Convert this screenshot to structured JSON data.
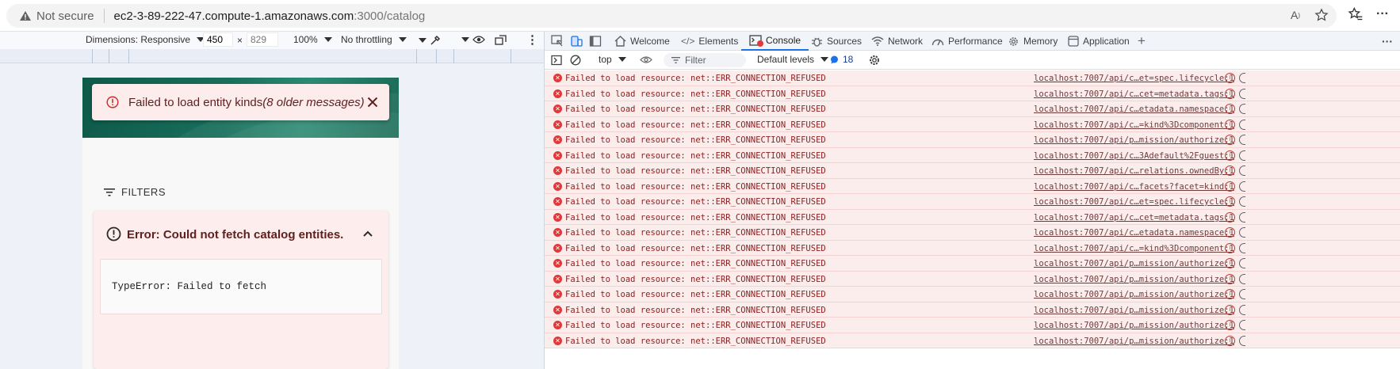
{
  "browser": {
    "security_label": "Not secure",
    "url_host": "ec2-3-89-222-47.compute-1.amazonaws.com",
    "url_path": ":3000/catalog",
    "more_label": "···"
  },
  "device_toolbar": {
    "dimensions_label": "Dimensions: Responsive",
    "width": "450",
    "times": "×",
    "height": "829",
    "zoom": "100%",
    "throttling": "No throttling"
  },
  "app": {
    "toast_message": "Failed to load entity kinds",
    "toast_older": "(8 older messages)",
    "filters_label": "FILTERS",
    "error_title": "Error: Could not fetch catalog entities.",
    "error_message": "TypeError: Failed to fetch"
  },
  "devtools": {
    "tabs": [
      {
        "label": "Welcome",
        "icon": "home-icon"
      },
      {
        "label": "Elements",
        "icon": "code-icon"
      },
      {
        "label": "Console",
        "icon": "console-icon"
      },
      {
        "label": "Sources",
        "icon": "bug-icon"
      },
      {
        "label": "Network",
        "icon": "wifi-icon"
      },
      {
        "label": "Performance",
        "icon": "gauge-icon"
      },
      {
        "label": "Memory",
        "icon": "gear-icon"
      },
      {
        "label": "Application",
        "icon": "window-icon"
      }
    ],
    "add_tab": "+",
    "more": "···",
    "console_bar": {
      "context": "top",
      "filter_placeholder": "Filter",
      "levels": "Default levels",
      "message_count": "18"
    },
    "log": [
      {
        "message": "Failed to load resource: net::ERR_CONNECTION_REFUSED",
        "source": "localhost:7007/api/c…et=spec.lifecycle:1"
      },
      {
        "message": "Failed to load resource: net::ERR_CONNECTION_REFUSED",
        "source": "localhost:7007/api/c…cet=metadata.tags:1"
      },
      {
        "message": "Failed to load resource: net::ERR_CONNECTION_REFUSED",
        "source": "localhost:7007/api/c…etadata.namespace:1"
      },
      {
        "message": "Failed to load resource: net::ERR_CONNECTION_REFUSED",
        "source": "localhost:7007/api/c…=kind%3Dcomponent:1"
      },
      {
        "message": "Failed to load resource: net::ERR_CONNECTION_REFUSED",
        "source": "localhost:7007/api/p…mission/authorize:1"
      },
      {
        "message": "Failed to load resource: net::ERR_CONNECTION_REFUSED",
        "source": "localhost:7007/api/c…3Adefault%2Fguest:1"
      },
      {
        "message": "Failed to load resource: net::ERR_CONNECTION_REFUSED",
        "source": "localhost:7007/api/c…relations.ownedBy:1"
      },
      {
        "message": "Failed to load resource: net::ERR_CONNECTION_REFUSED",
        "source": "localhost:7007/api/c…facets?facet=kind:1"
      },
      {
        "message": "Failed to load resource: net::ERR_CONNECTION_REFUSED",
        "source": "localhost:7007/api/c…et=spec.lifecycle:1"
      },
      {
        "message": "Failed to load resource: net::ERR_CONNECTION_REFUSED",
        "source": "localhost:7007/api/c…cet=metadata.tags:1"
      },
      {
        "message": "Failed to load resource: net::ERR_CONNECTION_REFUSED",
        "source": "localhost:7007/api/c…etadata.namespace:1"
      },
      {
        "message": "Failed to load resource: net::ERR_CONNECTION_REFUSED",
        "source": "localhost:7007/api/c…=kind%3Dcomponent:1"
      },
      {
        "message": "Failed to load resource: net::ERR_CONNECTION_REFUSED",
        "source": "localhost:7007/api/p…mission/authorize:1"
      },
      {
        "message": "Failed to load resource: net::ERR_CONNECTION_REFUSED",
        "source": "localhost:7007/api/p…mission/authorize:1"
      },
      {
        "message": "Failed to load resource: net::ERR_CONNECTION_REFUSED",
        "source": "localhost:7007/api/p…mission/authorize:1"
      },
      {
        "message": "Failed to load resource: net::ERR_CONNECTION_REFUSED",
        "source": "localhost:7007/api/p…mission/authorize:1"
      },
      {
        "message": "Failed to load resource: net::ERR_CONNECTION_REFUSED",
        "source": "localhost:7007/api/p…mission/authorize:1"
      },
      {
        "message": "Failed to load resource: net::ERR_CONNECTION_REFUSED",
        "source": "localhost:7007/api/p…mission/authorize:1"
      }
    ]
  },
  "colors": {
    "accent": "#1a73e8",
    "error_red": "#e0393a",
    "error_bg": "#fceded",
    "banner_green": "#196f5c"
  }
}
